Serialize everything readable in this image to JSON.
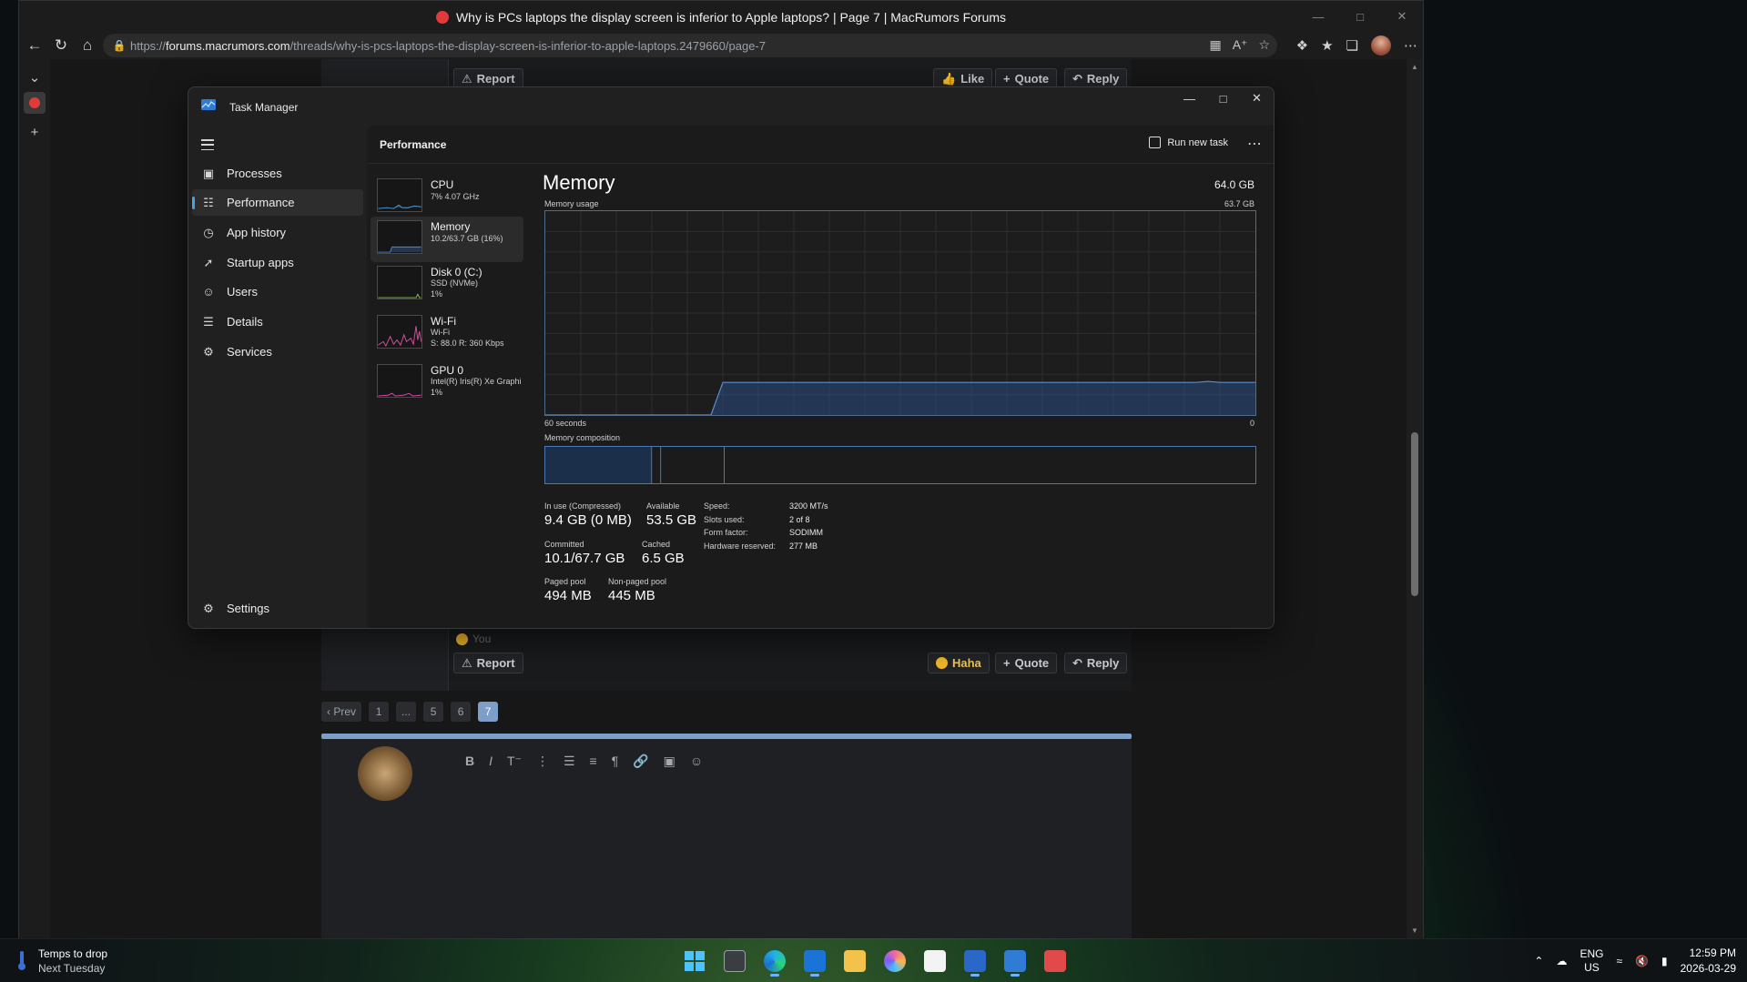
{
  "browser": {
    "window_title": "Why is PCs laptops the display screen is inferior to Apple laptops? | Page 7 | MacRumors Forums",
    "url_prefix": "https://",
    "url_host": "forums.macrumors.com",
    "url_path": "/threads/why-is-pcs-laptops-the-display-screen-is-inferior-to-apple-laptops.2479660/page-7"
  },
  "forum": {
    "report_label": "Report",
    "like_label": "Like",
    "quote_label": "Quote",
    "reply_label": "Reply",
    "haha_label": "Haha",
    "you_label": "You",
    "prev_label": "Prev",
    "pages": [
      "1",
      "...",
      "5",
      "6",
      "7"
    ],
    "current_page": "7"
  },
  "task_manager": {
    "title": "Task Manager",
    "nav": [
      {
        "label": "Processes",
        "icon": "processes-icon"
      },
      {
        "label": "Performance",
        "icon": "performance-icon"
      },
      {
        "label": "App history",
        "icon": "history-icon"
      },
      {
        "label": "Startup apps",
        "icon": "startup-icon"
      },
      {
        "label": "Users",
        "icon": "users-icon"
      },
      {
        "label": "Details",
        "icon": "details-icon"
      },
      {
        "label": "Services",
        "icon": "services-icon"
      }
    ],
    "settings_label": "Settings",
    "header_title": "Performance",
    "run_new_task_label": "Run new task",
    "resources": [
      {
        "name": "CPU",
        "sub": [
          "7% 4.07 GHz"
        ]
      },
      {
        "name": "Memory",
        "sub": [
          "10.2/63.7 GB (16%)"
        ]
      },
      {
        "name": "Disk 0 (C:)",
        "sub": [
          "SSD (NVMe)",
          "1%"
        ]
      },
      {
        "name": "Wi-Fi",
        "sub": [
          "Wi-Fi",
          "S: 88.0 R: 360 Kbps"
        ]
      },
      {
        "name": "GPU 0",
        "sub": [
          "Intel(R) Iris(R) Xe Graphi",
          "1%"
        ]
      }
    ],
    "memory": {
      "title": "Memory",
      "total": "64.0 GB",
      "usage_label": "Memory usage",
      "usage_max": "63.7 GB",
      "graph_left_label": "60 seconds",
      "graph_right_label": "0",
      "composition_label": "Memory composition",
      "in_use_label": "In use (Compressed)",
      "in_use_value": "9.4 GB (0 MB)",
      "available_label": "Available",
      "available_value": "53.5 GB",
      "committed_label": "Committed",
      "committed_value": "10.1/67.7 GB",
      "cached_label": "Cached",
      "cached_value": "6.5 GB",
      "paged_pool_label": "Paged pool",
      "paged_pool_value": "494 MB",
      "nonpaged_pool_label": "Non-paged pool",
      "nonpaged_pool_value": "445 MB",
      "speed_label": "Speed:",
      "speed_value": "3200 MT/s",
      "slots_label": "Slots used:",
      "slots_value": "2 of 8",
      "form_label": "Form factor:",
      "form_value": "SODIMM",
      "hw_reserved_label": "Hardware reserved:",
      "hw_reserved_value": "277 MB",
      "usage_history_fraction": [
        0,
        0,
        0,
        0,
        0,
        0,
        0,
        0,
        0,
        0,
        0,
        0,
        0,
        0,
        0,
        0.16,
        0.16,
        0.16,
        0.16,
        0.16,
        0.16,
        0.16,
        0.16,
        0.16,
        0.16,
        0.16,
        0.16,
        0.16,
        0.16,
        0.16,
        0.16,
        0.16,
        0.16,
        0.16,
        0.16,
        0.16,
        0.16,
        0.16,
        0.16,
        0.16,
        0.16,
        0.16,
        0.16,
        0.16,
        0.16,
        0.16,
        0.16,
        0.16,
        0.16,
        0.16,
        0.16,
        0.16,
        0.16,
        0.16,
        0.16,
        0.16,
        0.165,
        0.16,
        0.16,
        0.16,
        0.16
      ]
    }
  },
  "taskbar": {
    "weather_line1": "Temps to drop",
    "weather_line2": "Next Tuesday",
    "lang_line1": "ENG",
    "lang_line2": "US",
    "time": "12:59 PM",
    "date": "2026-03-29"
  }
}
